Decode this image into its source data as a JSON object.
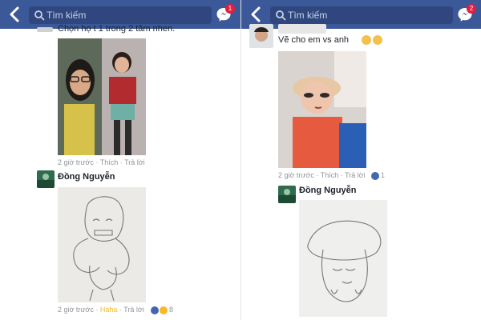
{
  "left": {
    "search_placeholder": "Tìm kiếm",
    "messenger_badge": "1",
    "top_comment_text": "Chọn họ t 1 trong 2 tâm nhen.",
    "meta1": {
      "time": "2 giờ trước",
      "like": "Thích",
      "reply": "Trả lời"
    },
    "commenter_name": "Đồng Nguyễn",
    "meta2": {
      "time": "2 giờ trước",
      "reaction": "Haha",
      "reply": "Trả lời",
      "count": "8"
    }
  },
  "right": {
    "search_placeholder": "Tìm kiếm",
    "messenger_badge": "2",
    "comment_text": "Vẽ cho em vs anh",
    "meta1": {
      "time": "2 giờ trước",
      "like": "Thích",
      "reply": "Trả lời",
      "count": "1"
    },
    "commenter_name": "Đồng Nguyễn"
  },
  "icons": {
    "back": "chevron-left-icon",
    "search": "search-icon",
    "messenger": "messenger-icon",
    "like": "like-icon",
    "haha": "haha-icon"
  },
  "colors": {
    "header": "#3b5998",
    "search_bg": "#2f477e",
    "badge": "#e41e3f"
  }
}
